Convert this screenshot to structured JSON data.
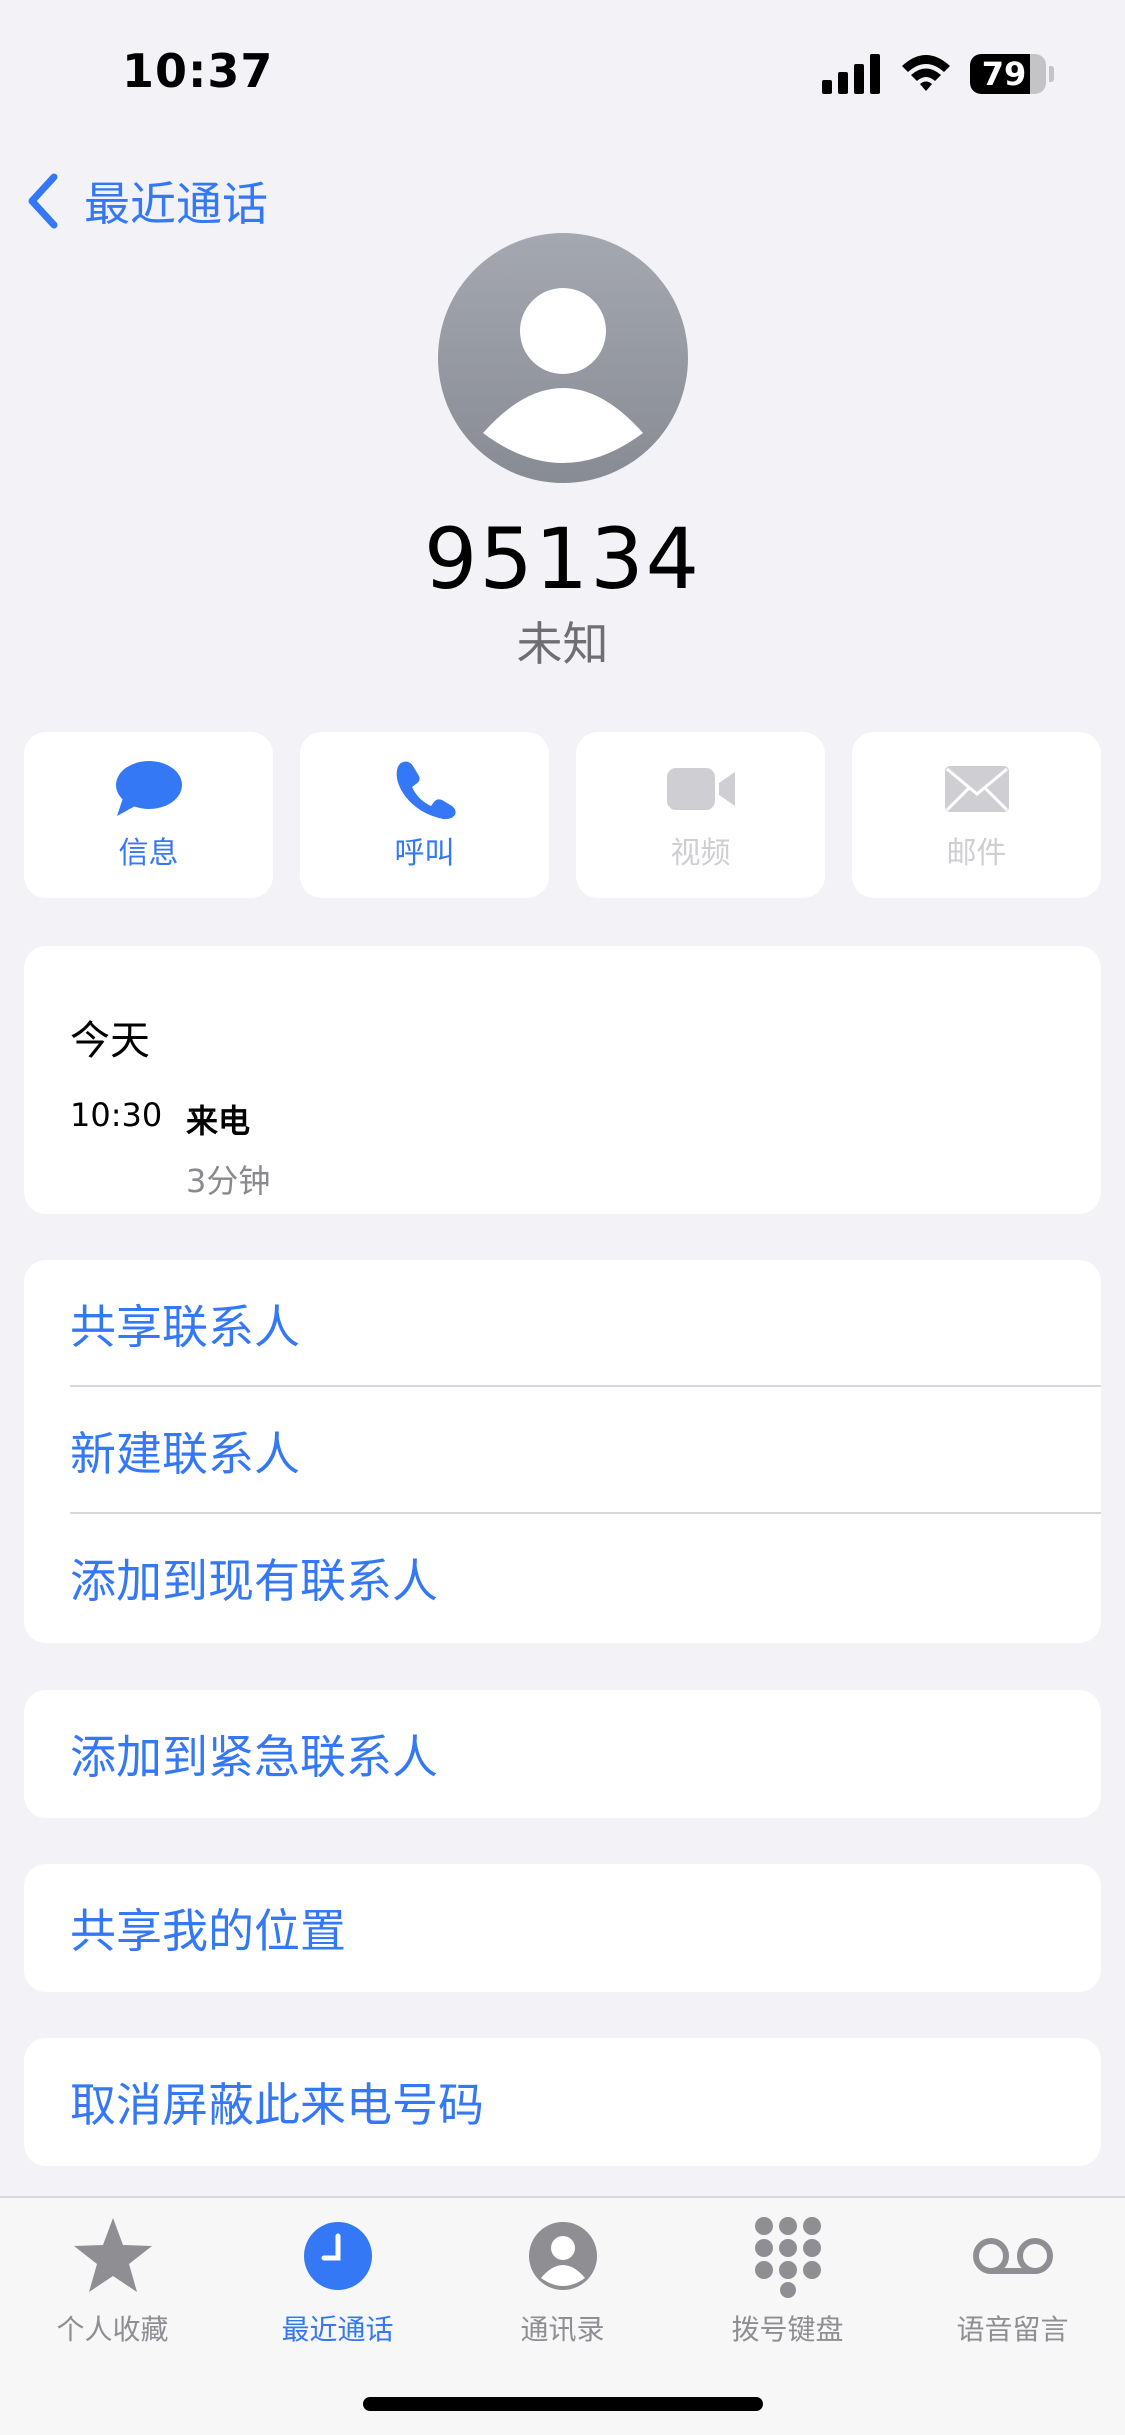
{
  "status_bar": {
    "time": "10:37",
    "battery": "79"
  },
  "nav": {
    "back_label": "最近通话"
  },
  "caller": {
    "number": "95134",
    "label": "未知"
  },
  "actions": [
    {
      "label": "信息",
      "icon": "message-icon",
      "enabled": true
    },
    {
      "label": "呼叫",
      "icon": "phone-icon",
      "enabled": true
    },
    {
      "label": "视频",
      "icon": "video-icon",
      "enabled": false
    },
    {
      "label": "邮件",
      "icon": "mail-icon",
      "enabled": false
    }
  ],
  "history": {
    "day": "今天",
    "entries": [
      {
        "time": "10:30",
        "type": "来电",
        "duration": "3分钟"
      }
    ]
  },
  "contact_options": [
    "共享联系人",
    "新建联系人",
    "添加到现有联系人"
  ],
  "emergency_option": "添加到紧急联系人",
  "location_option": "共享我的位置",
  "block_option": "取消屏蔽此来电号码",
  "tabs": [
    {
      "label": "个人收藏",
      "icon": "star-icon",
      "active": false
    },
    {
      "label": "最近通话",
      "icon": "clock-icon",
      "active": true
    },
    {
      "label": "通讯录",
      "icon": "contacts-icon",
      "active": false
    },
    {
      "label": "拨号键盘",
      "icon": "keypad-icon",
      "active": false
    },
    {
      "label": "语音留言",
      "icon": "voicemail-icon",
      "active": false
    }
  ],
  "colors": {
    "accent": "#3478f6",
    "disabled": "#cfcfd3",
    "background": "#f2f2f7"
  }
}
